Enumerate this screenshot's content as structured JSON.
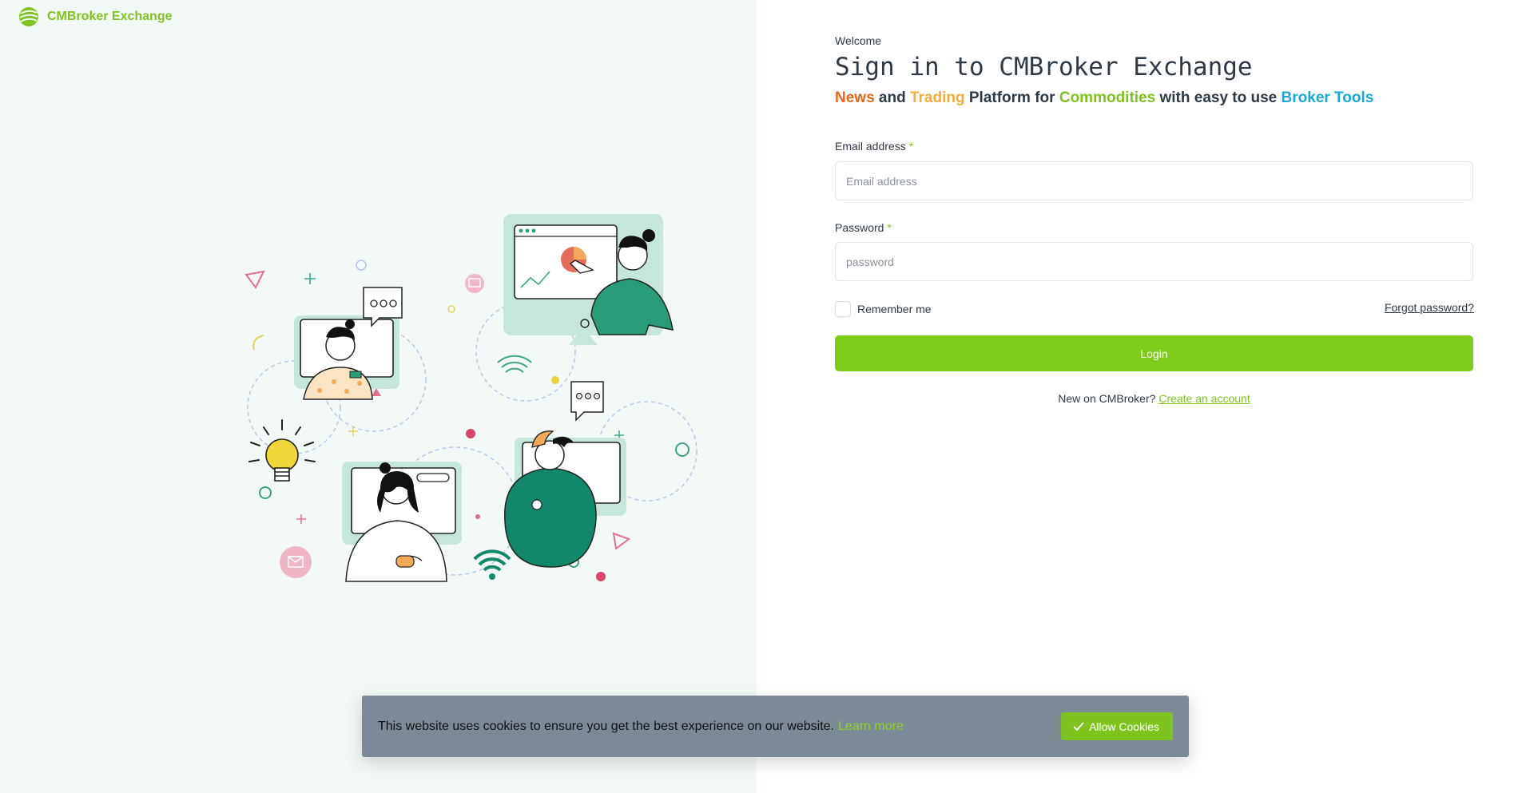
{
  "brand": {
    "name": "CMBroker Exchange",
    "logo_icon": "green-globe-logo-icon",
    "color": "#7ec31e"
  },
  "illustration": {
    "icon": "remote-meeting-illustration"
  },
  "login": {
    "welcome": "Welcome",
    "title": "Sign in to CMBroker Exchange",
    "tagline": {
      "news": "News",
      "and": " and ",
      "trading": "Trading",
      "platform_for": " Platform for ",
      "commodities": "Commodities",
      "with_easy": " with easy to use ",
      "broker_tools": "Broker Tools"
    },
    "email": {
      "label": "Email address",
      "required": "*",
      "placeholder": "Email address",
      "value": ""
    },
    "password": {
      "label": "Password",
      "required": "*",
      "placeholder": "password",
      "value": ""
    },
    "remember_label": "Remember me",
    "forgot_label": "Forgot password?",
    "login_button": "Login",
    "signup": {
      "text": "New on CMBroker?",
      "link": "Create an account"
    }
  },
  "cookie": {
    "text": "This website uses cookies to ensure you get the best experience on our website.",
    "learn_more": "Learn more",
    "allow_button": "Allow Cookies",
    "check_icon": "check-icon"
  },
  "colors": {
    "accent_green": "#80cc1a",
    "news_orange": "#e8651b",
    "trading_yellow": "#f2ad3c",
    "tools_blue": "#18a8d8",
    "left_background": "#f3f9f7",
    "cookie_background": "#7c8996"
  }
}
